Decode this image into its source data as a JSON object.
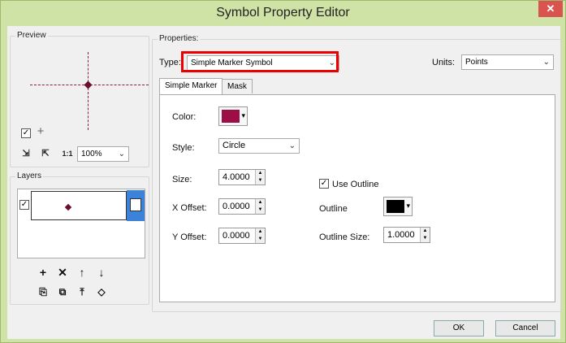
{
  "window": {
    "title": "Symbol Property Editor",
    "close_glyph": "✕"
  },
  "preview": {
    "label": "Preview",
    "add_icon_glyph": "+",
    "zoom_value": "100%",
    "tools": [
      "⇲",
      "⇱",
      "1:1"
    ]
  },
  "layers": {
    "label": "Layers",
    "actions": [
      "+",
      "✕",
      "↑",
      "↓"
    ],
    "actions2": [
      "⎘",
      "⧉",
      "⤒",
      "◇"
    ]
  },
  "properties": {
    "label": "Properties:",
    "type_label": "Type:",
    "type_value": "Simple Marker Symbol",
    "units_label": "Units:",
    "units_value": "Points",
    "tabs": [
      "Simple Marker",
      "Mask"
    ],
    "color_label": "Color:",
    "color_value": "#9e0e46",
    "style_label": "Style:",
    "style_value": "Circle",
    "size_label": "Size:",
    "size_value": "4.0000",
    "x_offset_label": "X Offset:",
    "x_offset_value": "0.0000",
    "y_offset_label": "Y Offset:",
    "y_offset_value": "0.0000",
    "use_outline_label": "Use Outline",
    "outline_label": "Outline",
    "outline_color": "#000000",
    "outline_size_label": "Outline Size:",
    "outline_size_value": "1.0000"
  },
  "buttons": {
    "ok": "OK",
    "cancel": "Cancel"
  },
  "glyphs": {
    "check": "✓",
    "down": "⌄",
    "caret": "▾",
    "spin_up": "▲",
    "spin_down": "▼"
  }
}
